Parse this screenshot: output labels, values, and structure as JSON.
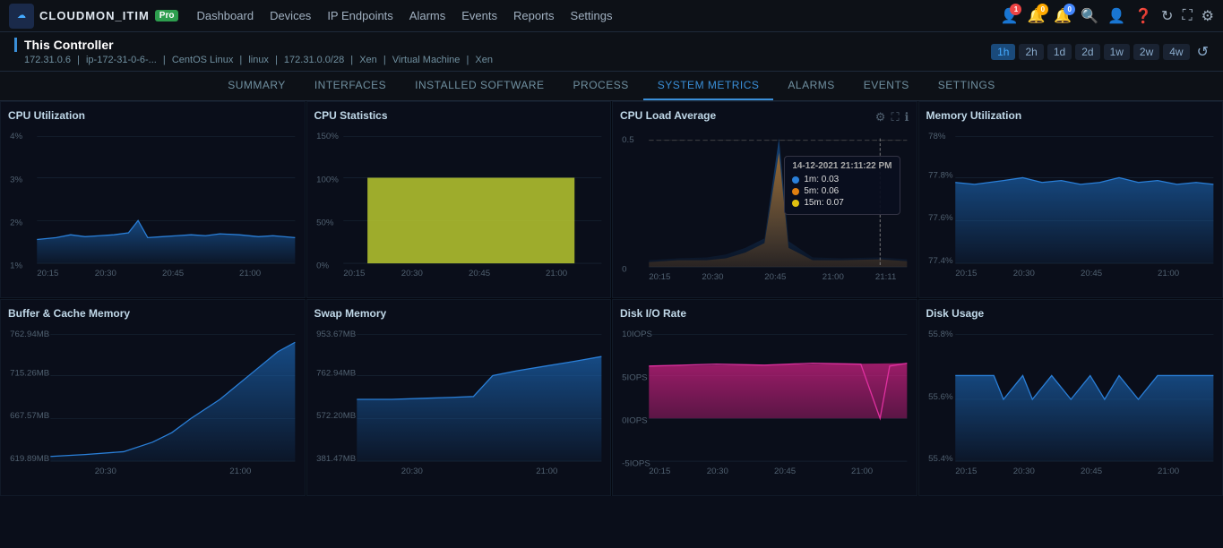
{
  "app": {
    "logo_text": "CLOUDMON_ITIM",
    "pro_badge": "Pro",
    "logo_icon": "☁"
  },
  "nav": {
    "links": [
      "Dashboard",
      "Devices",
      "IP Endpoints",
      "Alarms",
      "Events",
      "Reports",
      "Settings"
    ],
    "icons": [
      {
        "name": "person-alert-icon",
        "symbol": "👤",
        "badge": "1",
        "badge_color": "red"
      },
      {
        "name": "bell-icon",
        "symbol": "🔔",
        "badge": "0",
        "badge_color": "yellow"
      },
      {
        "name": "notification-icon",
        "symbol": "🔔",
        "badge": "0",
        "badge_color": "blue"
      }
    ],
    "action_icons": [
      "🔍",
      "👤",
      "❓",
      "↻",
      "⛶",
      "⚙"
    ]
  },
  "breadcrumb": {
    "title": "This Controller",
    "ip": "172.31.0.6",
    "hostname": "ip-172-31-0-6-...",
    "os": "CentOS Linux",
    "kernel": "linux",
    "subnet": "172.31.0.0/28",
    "hypervisor": "Xen",
    "type": "Virtual Machine",
    "platform": "Xen"
  },
  "time_range": {
    "buttons": [
      "1h",
      "2h",
      "1d",
      "2d",
      "1w",
      "2w",
      "4w"
    ],
    "active": "1h",
    "refresh_icon": "↺"
  },
  "tabs": {
    "items": [
      "SUMMARY",
      "INTERFACES",
      "INSTALLED SOFTWARE",
      "PROCESS",
      "SYSTEM METRICS",
      "ALARMS",
      "EVENTS",
      "SETTINGS"
    ],
    "active": "SYSTEM METRICS"
  },
  "charts": {
    "cpu_utilization": {
      "title": "CPU Utilization",
      "y_labels": [
        "4%",
        "3%",
        "2%",
        "1%"
      ],
      "x_labels": [
        "20:15",
        "20:30",
        "20:45",
        "21:00"
      ],
      "color": "#1a5fa8"
    },
    "cpu_statistics": {
      "title": "CPU Statistics",
      "y_labels": [
        "150%",
        "100%",
        "50%",
        "0%"
      ],
      "x_labels": [
        "20:15",
        "20:30",
        "20:45",
        "21:00"
      ],
      "color": "#b8c830"
    },
    "cpu_load_average": {
      "title": "CPU Load Average",
      "y_labels": [
        "0.5",
        "",
        "",
        "0"
      ],
      "x_labels": [
        "20:15",
        "20:30",
        "20:45",
        "21:00",
        "21:11"
      ],
      "color_1m": "#1a5fa8",
      "color_5m": "#e0a020",
      "color_15m": "#e0a020",
      "tooltip": {
        "time": "14-12-2021 21:11:22 PM",
        "label_1m": "1m: 0.03",
        "label_5m": "5m: 0.06",
        "label_15m": "15m: 0.07"
      }
    },
    "memory_utilization": {
      "title": "Memory Utilization",
      "y_labels": [
        "78%",
        "77.8%",
        "77.6%",
        "77.4%"
      ],
      "x_labels": [
        "20:15",
        "20:30",
        "20:45",
        "21:00"
      ],
      "color": "#1a5fa8"
    },
    "buffer_cache_memory": {
      "title": "Buffer & Cache Memory",
      "y_labels": [
        "762.94MB",
        "715.26MB",
        "667.57MB",
        "619.89MB"
      ],
      "x_labels": [
        "20:30",
        "21:00"
      ],
      "color": "#1a5fa8"
    },
    "swap_memory": {
      "title": "Swap Memory",
      "y_labels": [
        "953.67MB",
        "762.94MB",
        "572.20MB",
        "381.47MB"
      ],
      "x_labels": [
        "20:30",
        "21:00"
      ],
      "color": "#1a5fa8"
    },
    "disk_io_rate": {
      "title": "Disk I/O Rate",
      "y_labels": [
        "10IOPS",
        "5IOPS",
        "0IOPS",
        "-5IOPS"
      ],
      "x_labels": [
        "20:15",
        "20:30",
        "20:45",
        "21:00"
      ],
      "color": "#c82080"
    },
    "disk_usage": {
      "title": "Disk Usage",
      "y_labels": [
        "55.8%",
        "55.6%",
        "55.4%"
      ],
      "x_labels": [
        "20:15",
        "20:30",
        "20:45",
        "21:00"
      ],
      "color": "#1a5fa8"
    }
  }
}
